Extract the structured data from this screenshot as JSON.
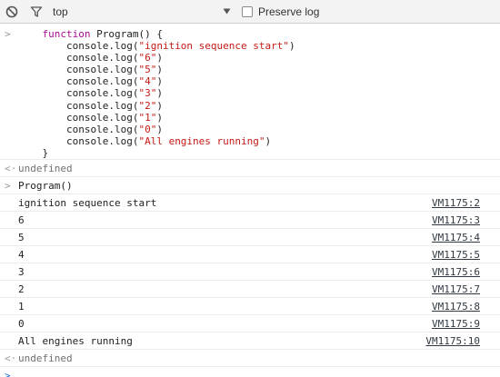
{
  "toolbar": {
    "context_label": "top",
    "preserve_log_label": "Preserve log",
    "preserve_log_checked": false
  },
  "console": {
    "input_code": [
      "    function Program() {",
      "        console.log(\"ignition sequence start\")",
      "        console.log(\"6\")",
      "        console.log(\"5\")",
      "        console.log(\"4\")",
      "        console.log(\"3\")",
      "        console.log(\"2\")",
      "        console.log(\"1\")",
      "        console.log(\"0\")",
      "        console.log(\"All engines running\")",
      "    }"
    ],
    "result_1": "undefined",
    "call_input": "Program()",
    "log_entries": [
      {
        "text": "ignition sequence start",
        "source": "VM1175:2"
      },
      {
        "text": "6",
        "source": "VM1175:3"
      },
      {
        "text": "5",
        "source": "VM1175:4"
      },
      {
        "text": "4",
        "source": "VM1175:5"
      },
      {
        "text": "3",
        "source": "VM1175:6"
      },
      {
        "text": "2",
        "source": "VM1175:7"
      },
      {
        "text": "1",
        "source": "VM1175:8"
      },
      {
        "text": "0",
        "source": "VM1175:9"
      },
      {
        "text": "All engines running",
        "source": "VM1175:10"
      }
    ],
    "result_2": "undefined",
    "prompt_icon": "chevron-right-icon",
    "result_icon": "return-arrow-icon"
  },
  "colors": {
    "keyword": "#aa0d91",
    "string": "#c41a16",
    "prompt_caret": "#1a73e8",
    "toolbar_bg": "#f3f3f3"
  }
}
